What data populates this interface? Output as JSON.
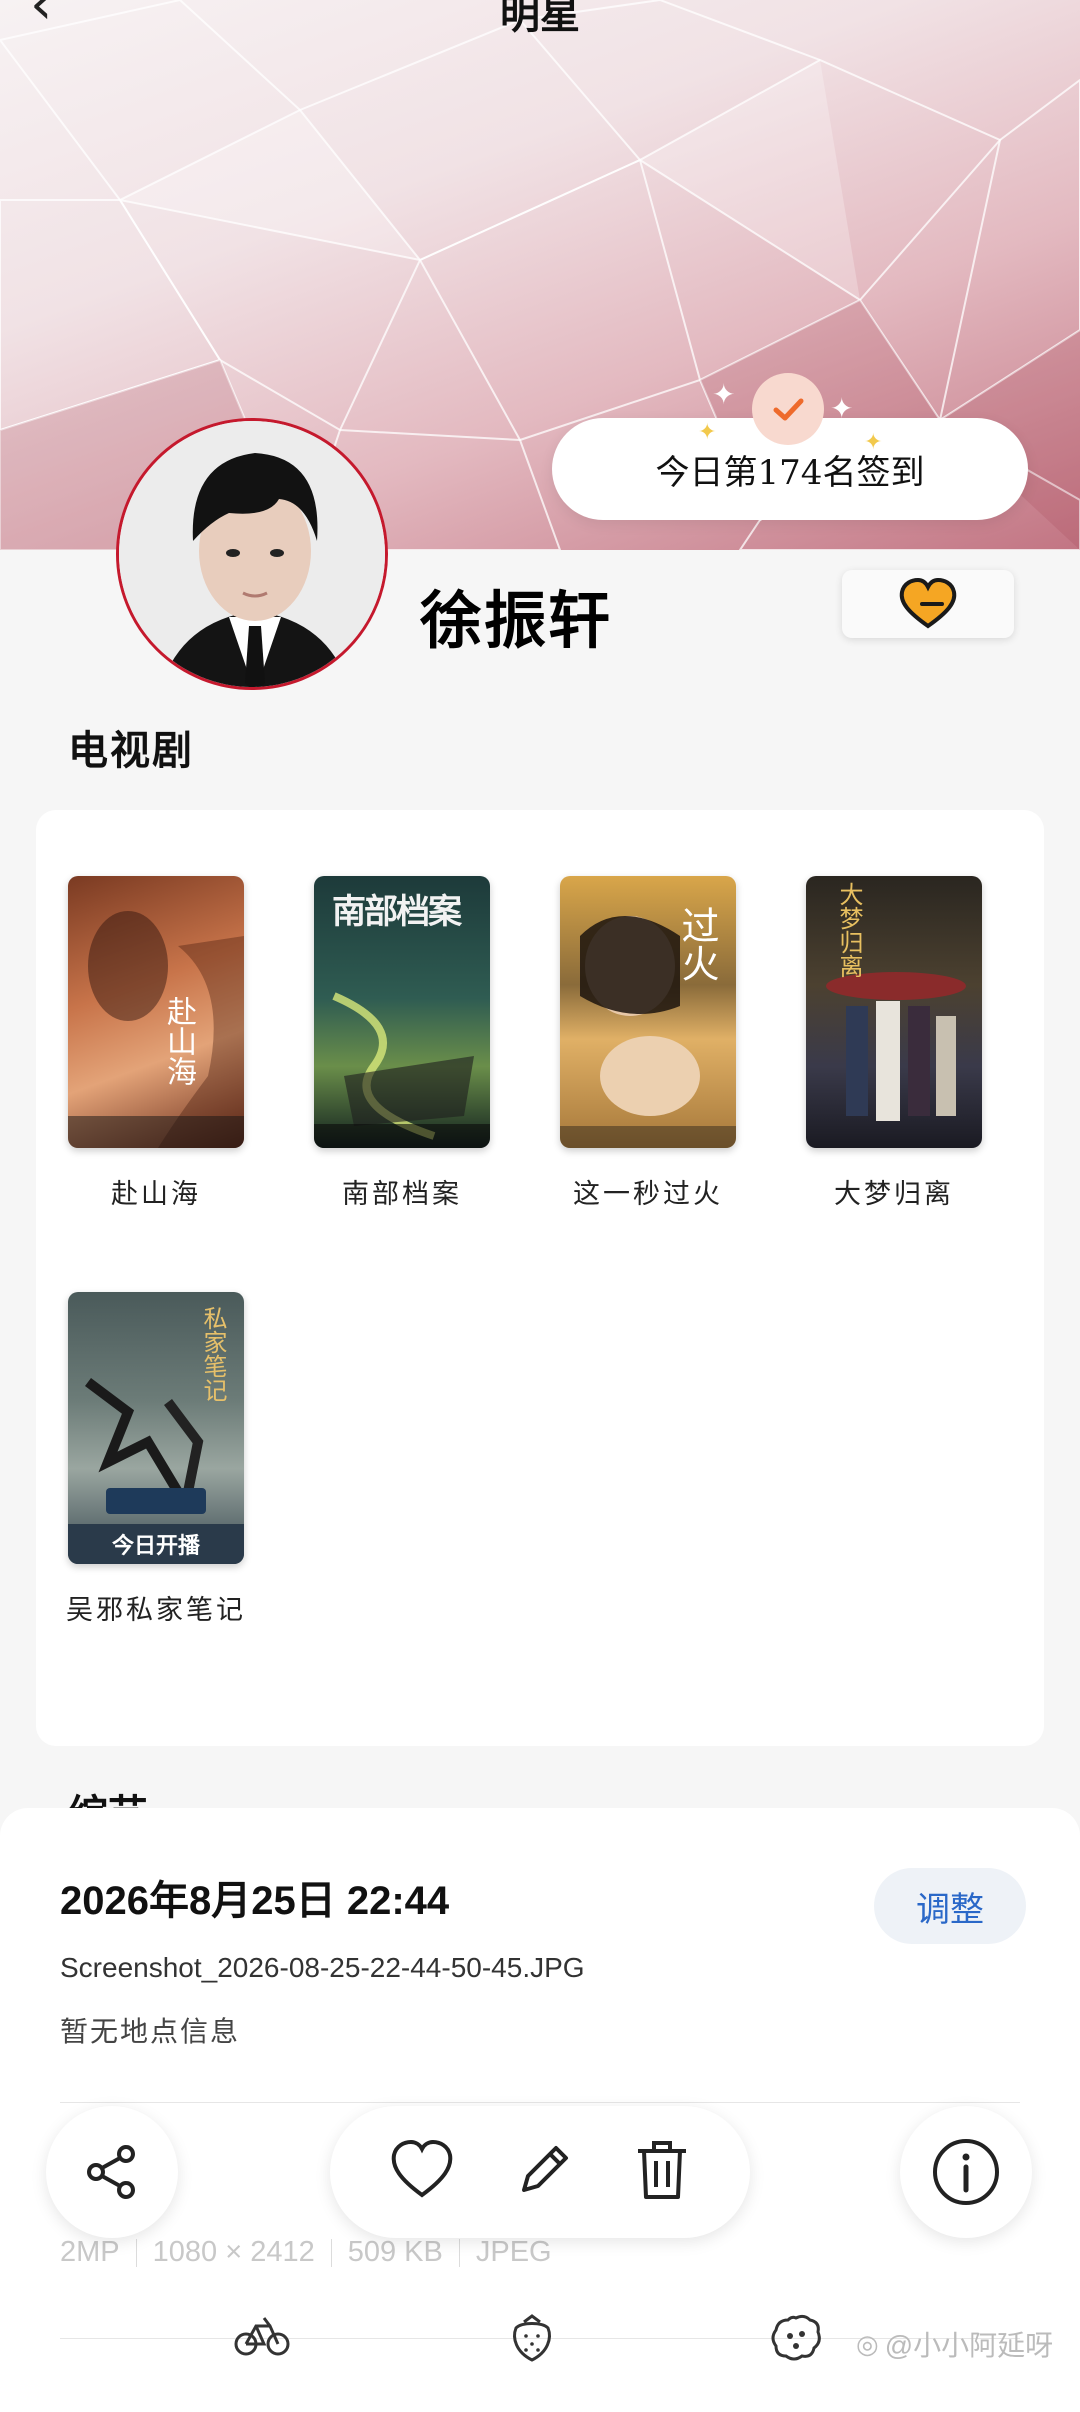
{
  "header": {
    "title": "明星",
    "back_icon": "back-arrow-icon"
  },
  "checkin": {
    "text": "今日第174名签到"
  },
  "profile": {
    "name": "徐振轩",
    "favorite_icon": "heart-icon"
  },
  "section": {
    "title": "电视剧",
    "dramas": [
      {
        "title": "赴山海",
        "poster_text": "赴山海"
      },
      {
        "title": "南部档案",
        "poster_text": "南部档案"
      },
      {
        "title": "这一秒过火",
        "poster_text": "过火"
      },
      {
        "title": "大梦归离",
        "poster_text": "大梦归离"
      },
      {
        "title": "吴邪私家笔记",
        "poster_text": "私家笔记",
        "poster_banner": "今日开播"
      }
    ],
    "next_section_partial": "综艺"
  },
  "info": {
    "datetime": "2026年8月25日 22:44",
    "adjust_label": "调整",
    "filename": "Screenshot_2026-08-25-22-44-50-45.JPG",
    "location": "暂无地点信息",
    "megapixels": "2MP",
    "resolution": "1080 × 2412",
    "filesize": "509 KB",
    "format": "JPEG"
  },
  "actions": {
    "share_icon": "share-icon",
    "like_icon": "heart-outline-icon",
    "edit_icon": "pencil-icon",
    "delete_icon": "trash-icon",
    "info_icon": "info-icon"
  },
  "watermark": {
    "text": "@小小阿延呀"
  },
  "colors": {
    "accent_blue": "#2a68c8",
    "avatar_border": "#c5192d",
    "heart": "#f5a623",
    "check": "#ee6a2c"
  }
}
